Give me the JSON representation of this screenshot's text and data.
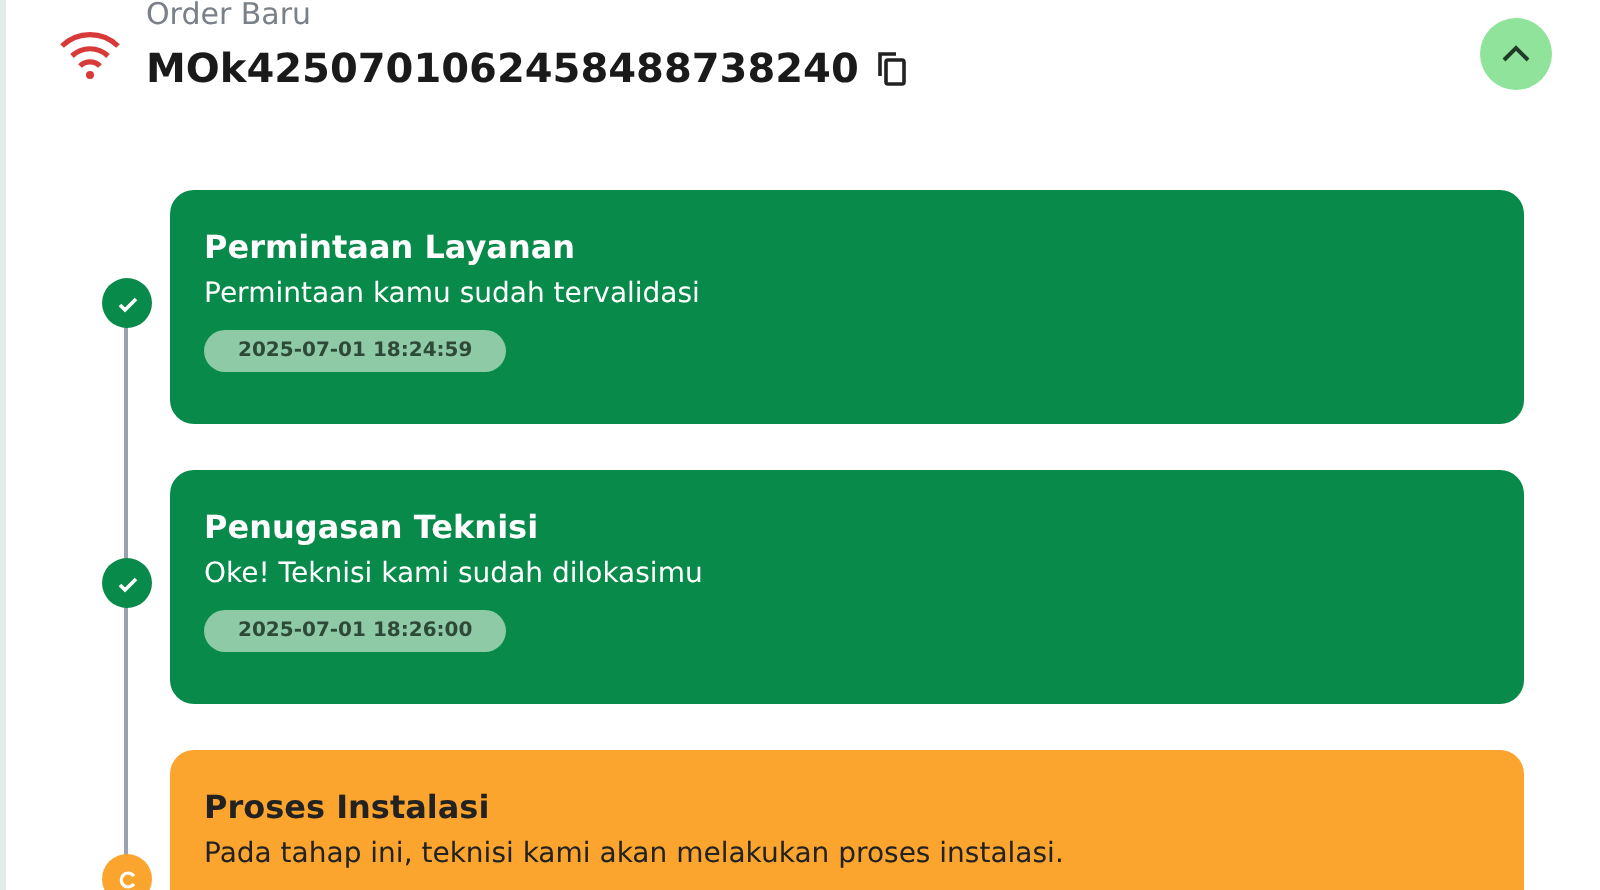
{
  "order": {
    "label": "Order Baru",
    "number": "MOk4250701062458488738240",
    "expanded": true
  },
  "steps": [
    {
      "kind": "done",
      "title": "Permintaan Layanan",
      "description": "Permintaan kamu sudah tervalidasi",
      "time": "2025-07-01 18:24:59"
    },
    {
      "kind": "done",
      "title": "Penugasan Teknisi",
      "description": "Oke! Teknisi kami sudah dilokasimu",
      "time": "2025-07-01 18:26:00"
    },
    {
      "kind": "in_progress",
      "title": "Proses Instalasi",
      "description": "Pada tahap ini, teknisi kami akan melakukan proses instalasi."
    }
  ]
}
